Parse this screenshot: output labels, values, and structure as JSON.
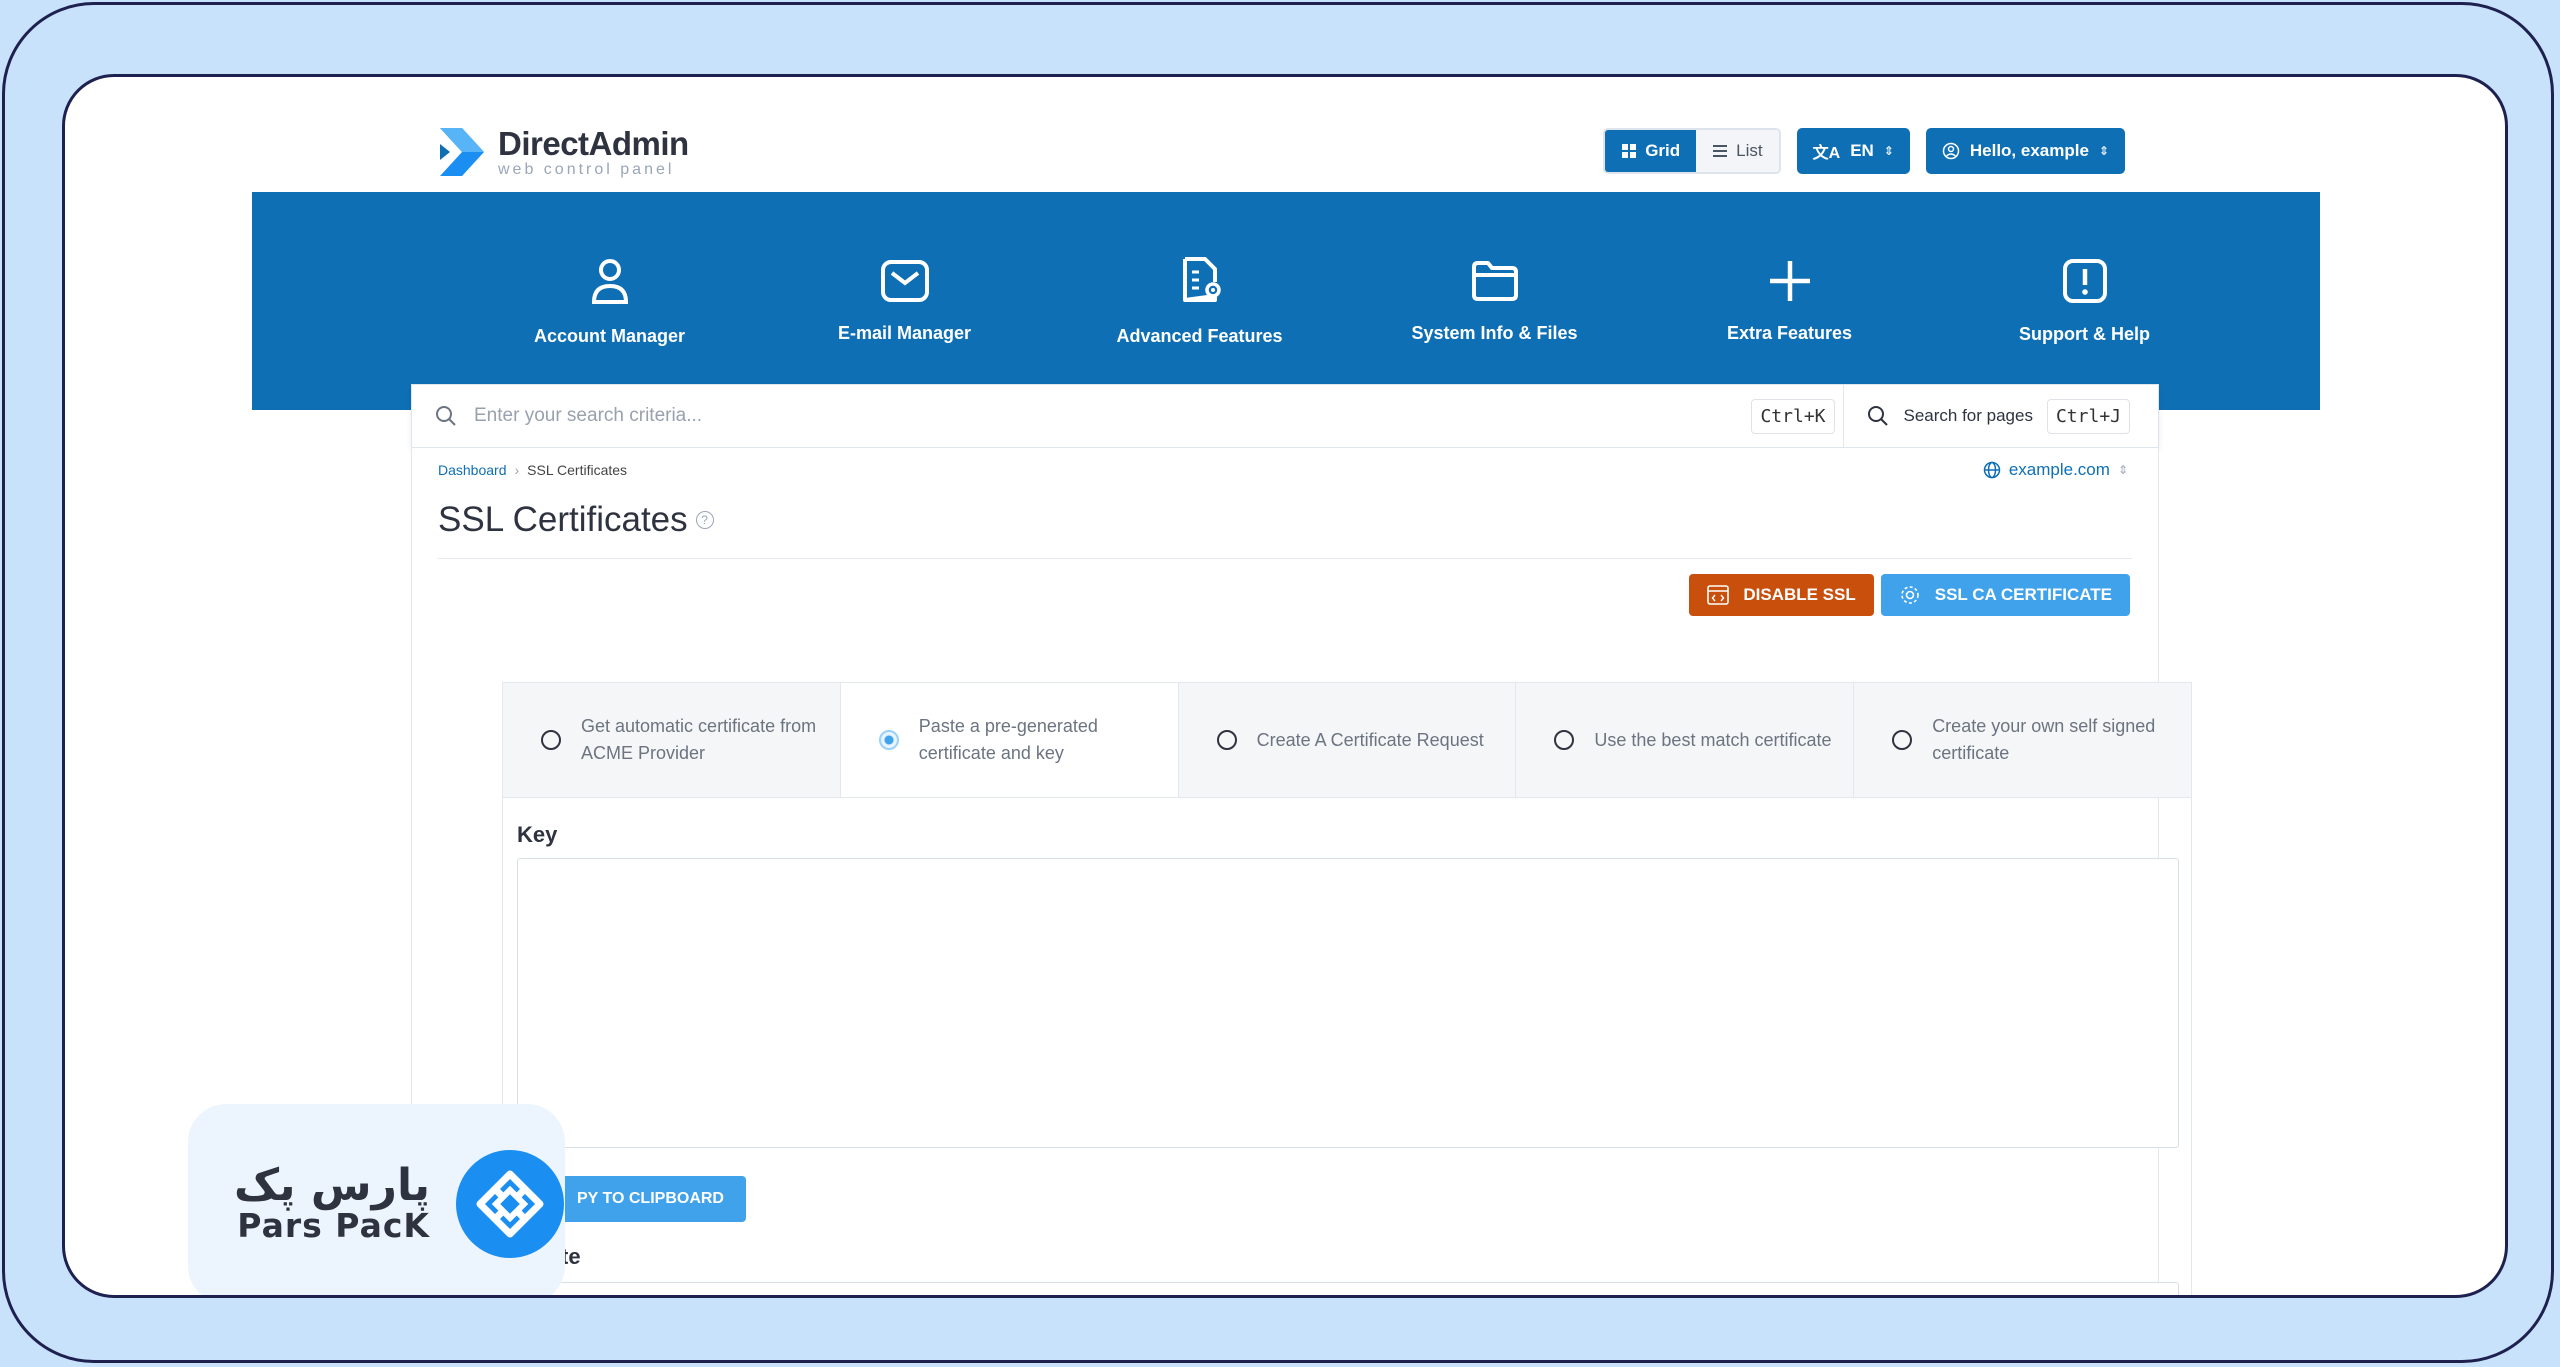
{
  "brand": {
    "title": "DirectAdmin",
    "subtitle": "web control panel"
  },
  "top_controls": {
    "grid_label": "Grid",
    "list_label": "List",
    "language": "EN",
    "user_greeting": "Hello, example"
  },
  "nav": {
    "items": [
      {
        "label": "Account Manager",
        "icon": "user-icon"
      },
      {
        "label": "E-mail Manager",
        "icon": "mail-icon"
      },
      {
        "label": "Advanced Features",
        "icon": "file-gear-icon"
      },
      {
        "label": "System Info & Files",
        "icon": "folder-icon"
      },
      {
        "label": "Extra Features",
        "icon": "plus-icon"
      },
      {
        "label": "Support & Help",
        "icon": "alert-icon"
      }
    ]
  },
  "search": {
    "placeholder": "Enter your search criteria...",
    "shortcut_main": "Ctrl+K",
    "pages_label": "Search for pages",
    "shortcut_pages": "Ctrl+J"
  },
  "breadcrumb": {
    "root": "Dashboard",
    "current": "SSL Certificates"
  },
  "domain": "example.com",
  "page": {
    "title": "SSL Certificates"
  },
  "actions": {
    "disable_ssl": "DISABLE SSL",
    "ssl_ca": "SSL CA CERTIFICATE"
  },
  "options": [
    {
      "label": "Get automatic certificate from ACME Provider",
      "selected": false
    },
    {
      "label": "Paste a pre-generated certificate and key",
      "selected": true
    },
    {
      "label": "Create A Certificate Request",
      "selected": false
    },
    {
      "label": "Use the best match certificate",
      "selected": false
    },
    {
      "label": "Create your own self signed certificate",
      "selected": false
    }
  ],
  "form": {
    "key_label": "Key",
    "copy_button": "PY TO CLIPBOARD",
    "cert_label": "ificate"
  },
  "watermark": {
    "fa_text": "پارس پک",
    "en_text": "Pars PacK"
  },
  "colors": {
    "primary": "#0f6fb4",
    "danger": "#c94f0c",
    "info": "#3fa2eb",
    "frame_bg": "#c9e2fb"
  }
}
